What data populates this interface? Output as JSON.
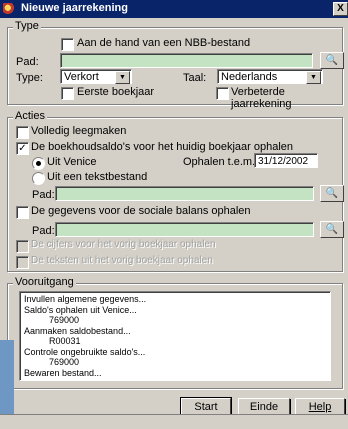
{
  "window": {
    "title": "Nieuwe jaarrekening",
    "close_label": "X"
  },
  "type_group": {
    "label": "Type",
    "nbb_checkbox": {
      "label": "Aan de hand van een NBB-bestand",
      "checked": false
    },
    "pad_label": "Pad:",
    "pad_value": "",
    "type_label": "Type:",
    "type_value": "Verkort",
    "taal_label": "Taal:",
    "taal_value": "Nederlands",
    "eerste_boekjaar": {
      "label": "Eerste boekjaar",
      "checked": false
    },
    "verbeterde": {
      "label": "Verbeterde jaarrekening",
      "checked": false
    }
  },
  "acties_group": {
    "label": "Acties",
    "volledig": {
      "label": "Volledig leegmaken",
      "checked": false
    },
    "boekhoud": {
      "label": "De boekhoudsaldo's voor het huidig boekjaar ophalen",
      "checked": true
    },
    "radio_venice": {
      "label": "Uit Venice",
      "selected": true
    },
    "ophalen_label": "Ophalen t.e.m.:",
    "ophalen_value": "31/12/2002",
    "radio_tekst": {
      "label": "Uit een tekstbestand",
      "selected": false
    },
    "pad1_label": "Pad:",
    "pad1_value": "",
    "sociale": {
      "label": "De gegevens voor de sociale balans ophalen",
      "checked": false
    },
    "pad2_label": "Pad:",
    "pad2_value": "",
    "cijfers": {
      "label": "De cijfers voor het vorig boekjaar ophalen",
      "checked": false
    },
    "teksten": {
      "label": "De teksten uit het vorig boekjaar ophalen",
      "checked": false
    }
  },
  "vooruitgang": {
    "label": "Vooruitgang",
    "lines": [
      "Invullen algemene gegevens...",
      "Saldo's ophalen uit Venice...",
      "          769000",
      "Aanmaken saldobestand...",
      "          R00031",
      "Controle ongebruikte saldo's...",
      "          769000",
      "Bewaren bestand..."
    ]
  },
  "buttons": {
    "start": "Start",
    "einde": "Einde",
    "help": "Help"
  },
  "colors": {
    "titlebar": "#0a246a",
    "field_green": "#c3e3c3",
    "face": "#d4d0c8"
  }
}
